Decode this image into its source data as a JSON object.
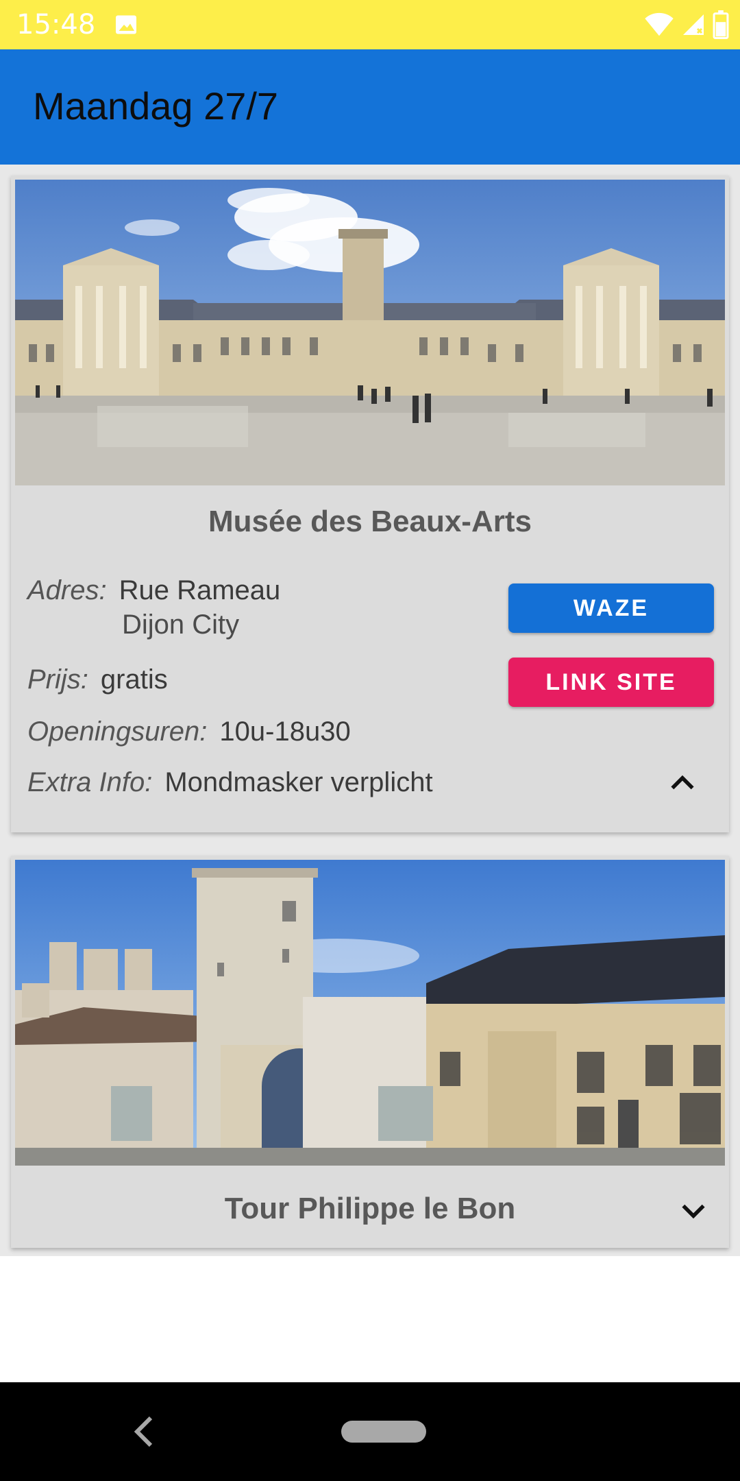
{
  "status_bar": {
    "time": "15:48",
    "icons": [
      "image-icon",
      "wifi-icon",
      "signal-icon",
      "battery-icon"
    ]
  },
  "app_bar": {
    "title": "Maandag 27/7"
  },
  "cards": [
    {
      "title": "Musée des Beaux-Arts",
      "image": "palace-courtyard-photo",
      "address_label": "Adres:",
      "address_line1": "Rue Rameau",
      "address_line2": "Dijon City",
      "price_label": "Prijs:",
      "price_value": "gratis",
      "hours_label": "Openingsuren:",
      "hours_value": "10u-18u30",
      "extra_label": "Extra Info:",
      "extra_value": "Mondmasker verplicht",
      "waze_label": "WAZE",
      "link_label": "LINK SITE",
      "expanded": true
    },
    {
      "title": "Tour Philippe le Bon",
      "image": "tower-street-photo",
      "expanded": false
    }
  ],
  "colors": {
    "status_bar": "#fdee4a",
    "app_bar": "#1473d8",
    "waze_button": "#1470d6",
    "link_button": "#e71d61",
    "card_bg": "#dcdcdc"
  }
}
